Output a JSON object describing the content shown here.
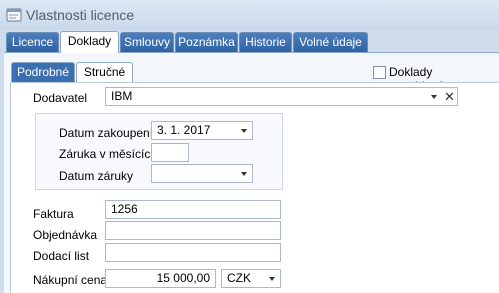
{
  "window": {
    "title": "Vlastnosti licence",
    "icon": "document-icon"
  },
  "tabs": [
    {
      "label": "Licence",
      "active": false
    },
    {
      "label": "Doklady",
      "active": true
    },
    {
      "label": "Smlouvy",
      "active": false
    },
    {
      "label": "Poznámka",
      "active": false
    },
    {
      "label": "Historie",
      "active": false
    },
    {
      "label": "Volné údaje",
      "active": false
    }
  ],
  "subtabs": [
    {
      "label": "Podrobné",
      "active": true
    },
    {
      "label": "Stručné",
      "active": false
    }
  ],
  "checkbox": {
    "label": "Doklady neevidovány",
    "checked": false
  },
  "form": {
    "supplier": {
      "label": "Dodavatel",
      "value": "IBM"
    },
    "purchase_date": {
      "label": "Datum zakoupení",
      "value": "3. 1. 2017"
    },
    "warranty_months": {
      "label": "Záruka v měsících",
      "value": ""
    },
    "warranty_date": {
      "label": "Datum záruky",
      "value": ""
    },
    "invoice": {
      "label": "Faktura",
      "value": "1256"
    },
    "order": {
      "label": "Objednávka",
      "value": ""
    },
    "delivery_note": {
      "label": "Dodací list",
      "value": ""
    },
    "price": {
      "label": "Nákupní cena",
      "value": "15 000,00"
    },
    "currency": {
      "value": "CZK"
    }
  },
  "colors": {
    "tab_blue": "#3c6fb0",
    "background": "#cfdcec",
    "title_text": "#555d68"
  }
}
